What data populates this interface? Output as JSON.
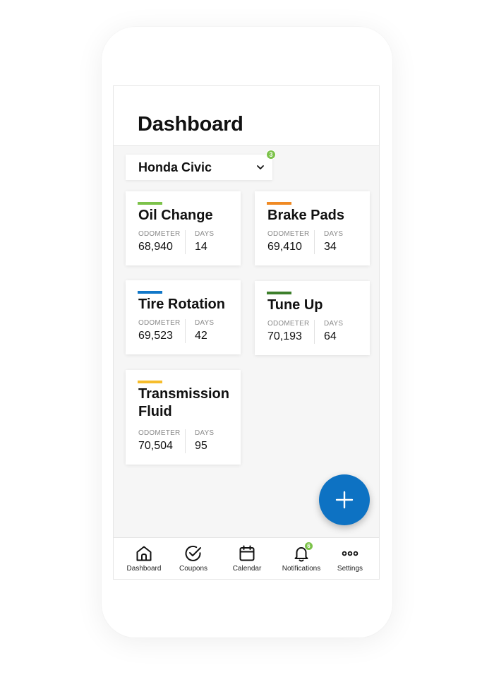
{
  "header": {
    "title": "Dashboard"
  },
  "vehicle": {
    "name": "Honda Civic",
    "badge": "3"
  },
  "services": [
    {
      "name": "Oil Change",
      "color": "#7cc24a",
      "odometer_label": "ODOMETER",
      "odometer": "68,940",
      "days_label": "DAYS",
      "days": "14"
    },
    {
      "name": "Brake Pads",
      "color": "#f08a24",
      "odometer_label": "ODOMETER",
      "odometer": "69,410",
      "days_label": "DAYS",
      "days": "34"
    },
    {
      "name": "Tire Rotation",
      "color": "#1177c8",
      "odometer_label": "ODOMETER",
      "odometer": "69,523",
      "days_label": "DAYS",
      "days": "42"
    },
    {
      "name": "Tune Up",
      "color": "#3d7f2b",
      "odometer_label": "ODOMETER",
      "odometer": "70,193",
      "days_label": "DAYS",
      "days": "64"
    },
    {
      "name": "Transmission Fluid",
      "color": "#f6bd2c",
      "odometer_label": "ODOMETER",
      "odometer": "70,504",
      "days_label": "DAYS",
      "days": "95"
    }
  ],
  "fab": {
    "icon": "plus-icon",
    "color": "#0d72c3"
  },
  "tabs": [
    {
      "label": "Dashboard",
      "icon": "home-icon"
    },
    {
      "label": "Coupons",
      "icon": "check-circle-icon"
    },
    {
      "label": "Calendar",
      "icon": "calendar-icon"
    },
    {
      "label": "Notifications",
      "icon": "bell-icon",
      "badge": "6"
    },
    {
      "label": "Settings",
      "icon": "more-icon"
    }
  ]
}
